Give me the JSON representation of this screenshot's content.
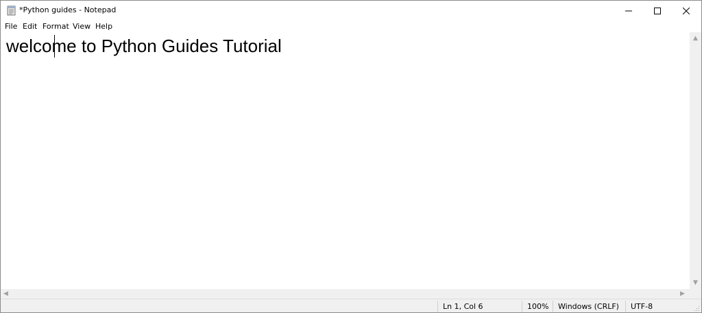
{
  "window": {
    "title": "*Python guides - Notepad",
    "minimize_glyph": "–",
    "maximize_glyph": "□",
    "close_glyph": "✕"
  },
  "menu": [
    "File",
    "Edit",
    "Format",
    "View",
    "Help"
  ],
  "editor": {
    "text": "welcome to Python Guides Tutorial",
    "cursor": {
      "line": 1,
      "col": 6
    }
  },
  "status": {
    "position": "Ln 1, Col 6",
    "zoom": "100%",
    "line_endings": "Windows (CRLF)",
    "encoding": "UTF-8"
  },
  "icons": {
    "app": "notepad-icon",
    "minimize": "minimize-icon",
    "maximize": "maximize-icon",
    "close": "close-icon"
  },
  "colors": {
    "window_bg": "#ffffff",
    "statusbar_bg": "#f0f0f0",
    "scrollbar_bg": "#f0f0f0",
    "text": "#000000",
    "border": "#8a8a8a"
  }
}
